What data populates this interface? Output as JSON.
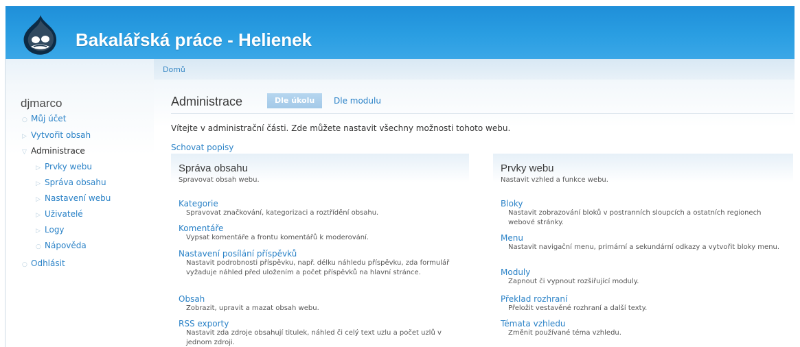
{
  "header": {
    "site_name": "Bakalářská práce - Helienek",
    "logo": "drupal-drop-logo"
  },
  "breadcrumb": {
    "home": "Domů"
  },
  "sidebar": {
    "user": "djmarco",
    "items": [
      {
        "label": "Můj účet",
        "level": 0,
        "bullet": "circle"
      },
      {
        "label": "Vytvořit obsah",
        "level": 0,
        "bullet": "triangle-right"
      },
      {
        "label": "Administrace",
        "level": 0,
        "bullet": "triangle-down",
        "active": true
      },
      {
        "label": "Prvky webu",
        "level": 1,
        "bullet": "triangle-right"
      },
      {
        "label": "Správa obsahu",
        "level": 1,
        "bullet": "triangle-right"
      },
      {
        "label": "Nastavení webu",
        "level": 1,
        "bullet": "triangle-right"
      },
      {
        "label": "Uživatelé",
        "level": 1,
        "bullet": "triangle-right"
      },
      {
        "label": "Logy",
        "level": 1,
        "bullet": "triangle-right"
      },
      {
        "label": "Nápověda",
        "level": 1,
        "bullet": "circle"
      },
      {
        "label": "Odhlásit",
        "level": 0,
        "bullet": "circle"
      }
    ]
  },
  "main": {
    "title": "Administrace",
    "tabs": [
      {
        "label": "Dle úkolu",
        "active": true
      },
      {
        "label": "Dle modulu",
        "active": false
      }
    ],
    "welcome": "Vítejte v administrační části. Zde můžete nastavit všechny možnosti tohoto webu.",
    "hide_descriptions": "Schovat popisy",
    "sections": [
      {
        "title": "Správa obsahu",
        "description": "Spravovat obsah webu.",
        "entries": [
          {
            "title": "Kategorie",
            "description": "Spravovat značkování, kategorizaci a roztřídění obsahu."
          },
          {
            "title": "Komentáře",
            "description": "Vypsat komentáře a frontu komentářů k moderování."
          },
          {
            "title": "Nastavení posílání příspěvků",
            "description": "Nastavit podrobnosti příspěvku, např. délku náhledu příspěvku, zda formulář vyžaduje náhled před uložením a počet příspěvků na hlavní stránce."
          },
          {
            "title": "Obsah",
            "description": "Zobrazit, upravit a mazat obsah webu."
          },
          {
            "title": "RSS exporty",
            "description": "Nastavit zda zdroje obsahují titulek, náhled či celý text uzlu a počet uzlů v jednom zdroji."
          }
        ]
      },
      {
        "title": "Prvky webu",
        "description": "Nastavit vzhled a funkce webu.",
        "entries": [
          {
            "title": "Bloky",
            "description": "Nastavit zobrazování bloků v postranních sloupcích a ostatních regionech webové stránky."
          },
          {
            "title": "Menu",
            "description": "Nastavit navigační menu, primární a sekundární odkazy a vytvořit bloky menu."
          },
          {
            "title": "Moduly",
            "description": "Zapnout či vypnout rozšiřující moduly."
          },
          {
            "title": "Překlad rozhraní",
            "description": "Přeložit vestavěné rozhraní a další texty."
          },
          {
            "title": "Témata vzhledu",
            "description": "Změnit používané téma vzhledu."
          }
        ]
      }
    ]
  },
  "colors": {
    "header_blue": "#2a9ee2",
    "link": "#2a82c7",
    "tab_active_bg": "#aacee9"
  }
}
